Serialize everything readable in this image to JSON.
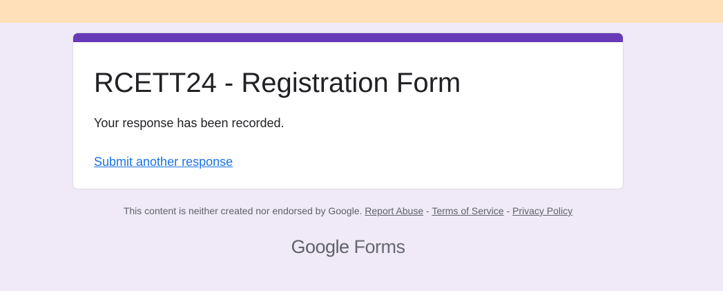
{
  "form": {
    "title": "RCETT24 - Registration Form",
    "confirmation_message": "Your response has been recorded.",
    "submit_another_label": "Submit another response"
  },
  "footer": {
    "disclaimer": "This content is neither created nor endorsed by Google.",
    "report_abuse": "Report Abuse",
    "separator": "-",
    "terms": "Terms of Service",
    "privacy": "Privacy Policy"
  },
  "brand": {
    "google": "Google",
    "product": "Forms"
  },
  "colors": {
    "accent": "#673ab7",
    "page_background": "#efe9f8",
    "top_band": "#ffe0b8",
    "link": "#1a73e8"
  }
}
